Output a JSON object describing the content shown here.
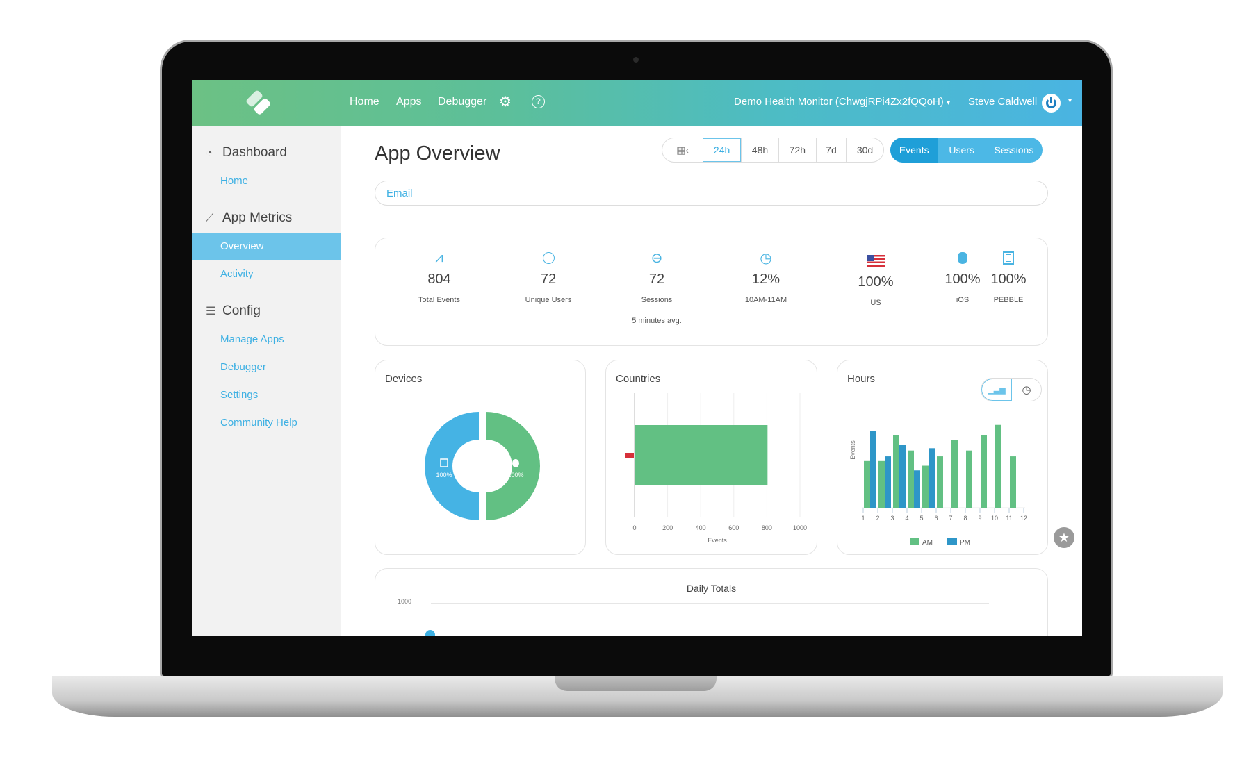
{
  "header": {
    "nav": [
      "Home",
      "Apps",
      "Debugger"
    ],
    "app_selector": "Demo Health Monitor (ChwgjRPi4Zx2fQQoH)",
    "user_name": "Steve Caldwell",
    "caret": "▾"
  },
  "sidebar": {
    "sections": [
      {
        "title": "Dashboard",
        "icon": "gauge-icon",
        "items": [
          "Home"
        ]
      },
      {
        "title": "App Metrics",
        "icon": "chart-line-icon",
        "items": [
          "Overview",
          "Activity"
        ]
      },
      {
        "title": "Config",
        "icon": "toggles-icon",
        "items": [
          "Manage Apps",
          "Debugger",
          "Settings",
          "Community Help"
        ]
      }
    ],
    "active": "Overview"
  },
  "main": {
    "title": "App Overview",
    "time_ranges": [
      "24h",
      "48h",
      "72h",
      "7d",
      "30d"
    ],
    "time_selected": "24h",
    "metrics": [
      "Events",
      "Users",
      "Sessions"
    ],
    "metric_selected": "Events",
    "email_placeholder": "Email",
    "stats": [
      {
        "icon": "trend-icon",
        "value": "804",
        "label": "Total Events"
      },
      {
        "icon": "user-icon",
        "value": "72",
        "label": "Unique Users"
      },
      {
        "icon": "session-icon",
        "value": "72",
        "label": "Sessions",
        "sub": "5 minutes avg."
      },
      {
        "icon": "clock-icon",
        "value": "12%",
        "label": "10AM-11AM"
      },
      {
        "icon": "us-flag-icon",
        "value": "100%",
        "label": "US"
      },
      {
        "icon": "apple-icon",
        "value": "100%",
        "label": "iOS"
      },
      {
        "icon": "pebble-icon",
        "value": "100%",
        "label": "PEBBLE"
      }
    ],
    "devices": {
      "title": "Devices"
    },
    "countries": {
      "title": "Countries"
    },
    "hours": {
      "title": "Hours"
    },
    "daily": {
      "title": "Daily Totals",
      "y_tick": "1000"
    }
  },
  "colors": {
    "accent": "#3db0e3",
    "am": "#62c083",
    "pm": "#2e96c8",
    "pebble": "#45b3e4",
    "ios": "#62c083"
  },
  "chart_data": [
    {
      "type": "pie",
      "title": "Devices",
      "slices": [
        {
          "label": "PEBBLE",
          "value": 100,
          "text": "100%"
        },
        {
          "label": "iOS",
          "value": 100,
          "text": "100%"
        }
      ]
    },
    {
      "type": "bar",
      "orientation": "horizontal",
      "title": "Countries",
      "categories": [
        "US"
      ],
      "values": [
        804
      ],
      "xlabel": "Events",
      "xlim": [
        0,
        1000
      ],
      "xticks": [
        "0",
        "200",
        "400",
        "600",
        "800",
        "1000"
      ],
      "grid": true
    },
    {
      "type": "bar",
      "title": "Hours",
      "categories": [
        "1",
        "2",
        "3",
        "4",
        "5",
        "6",
        "7",
        "8",
        "9",
        "10",
        "11",
        "12"
      ],
      "ylabel": "Events",
      "series": [
        {
          "name": "AM",
          "values": [
            40,
            40,
            62,
            49,
            36,
            44,
            58,
            49,
            62,
            71,
            44,
            0
          ]
        },
        {
          "name": "PM",
          "values": [
            66,
            44,
            54,
            32,
            51,
            0,
            0,
            0,
            0,
            0,
            0,
            0
          ]
        }
      ],
      "legend": "bottom"
    },
    {
      "type": "line",
      "title": "Daily Totals",
      "yticks": [
        "1000"
      ]
    }
  ]
}
